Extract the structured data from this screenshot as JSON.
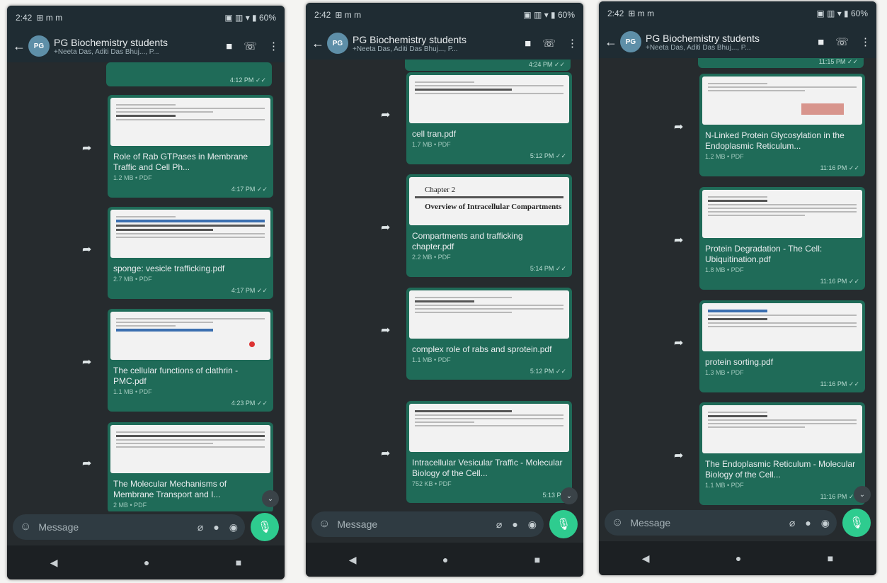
{
  "screens": [
    {
      "status": {
        "time": "2:42",
        "left_icons": "⊞ m m",
        "right_icons": "▣ ▥ ▾ ▮ 60%"
      },
      "header": {
        "name": "PG Biochemistry students",
        "members": "+Neeta Das, Aditi Das Bhuj..., P...",
        "avatar_text": "PG"
      },
      "top_time": "4:12 PM ✓✓",
      "messages": [
        {
          "preview": "plain",
          "file": "Role of Rab GTPases in Membrane Traffic and Cell Ph...",
          "meta": "1.2 MB • PDF",
          "time": "4:17 PM ✓✓"
        },
        {
          "preview": "blue",
          "file": "sponge: vesicle trafficking.pdf",
          "meta": "2.7 MB • PDF",
          "time": "4:17 PM ✓✓"
        },
        {
          "preview": "red",
          "file": "The cellular functions of clathrin - PMC.pdf",
          "meta": "1.1 MB • PDF",
          "time": "4:23 PM ✓✓"
        },
        {
          "preview": "plain",
          "file": "The Molecular Mechanisms of Membrane Transport and I...",
          "meta": "2 MB • PDF",
          "time": ""
        }
      ],
      "input": {
        "placeholder": "Message"
      }
    },
    {
      "status": {
        "time": "2:42",
        "left_icons": "⊞ m m",
        "right_icons": "▣ ▥ ▾ ▮ 60%"
      },
      "header": {
        "name": "PG Biochemistry students",
        "members": "+Neeta Das, Aditi Das Bhuj..., P...",
        "avatar_text": "PG"
      },
      "top_time": "4:24 PM ✓✓",
      "messages": [
        {
          "preview": "plain",
          "file": "cell tran.pdf",
          "meta": "1.7 MB • PDF",
          "time": "5:12 PM ✓✓"
        },
        {
          "preview": "chapter",
          "preview_title": "Overview of Intracellular Compartments",
          "preview_head": "Chapter 2",
          "file": "Compartments and trafficking chapter.pdf",
          "meta": "2.2 MB • PDF",
          "time": "5:14 PM ✓✓"
        },
        {
          "preview": "plain",
          "file": "complex role of rabs and sprotein.pdf",
          "meta": "1.1 MB • PDF",
          "time": "5:12 PM ✓✓"
        },
        {
          "preview": "plain",
          "file": "Intracellular Vesicular Traffic - Molecular Biology of the Cell...",
          "meta": "752 KB • PDF",
          "time": "5:13 PM"
        }
      ],
      "input": {
        "placeholder": "Message"
      }
    },
    {
      "status": {
        "time": "2:42",
        "left_icons": "⊞ m m",
        "right_icons": "▣ ▥ ▾ ▮ 60%"
      },
      "header": {
        "name": "PG Biochemistry students",
        "members": "+Neeta Das, Aditi Das Bhuj..., P...",
        "avatar_text": "PG"
      },
      "top_time": "11:15 PM ✓✓",
      "messages": [
        {
          "preview": "seal",
          "file": "N-Linked Protein Glycosylation in the Endoplasmic Reticulum...",
          "meta": "1.2 MB • PDF",
          "time": "11:16 PM ✓✓"
        },
        {
          "preview": "plain",
          "file": "Protein Degradation - The Cell: Ubiquitination.pdf",
          "meta": "1.8 MB • PDF",
          "time": "11:16 PM ✓✓"
        },
        {
          "preview": "plain",
          "file": "protein sorting.pdf",
          "meta": "1.3 MB • PDF",
          "time": "11:16 PM ✓✓"
        },
        {
          "preview": "plain",
          "file": "The Endoplasmic Reticulum - Molecular Biology of the Cell...",
          "meta": "1.1 MB • PDF",
          "time": "11:16 PM ✓✓"
        }
      ],
      "input": {
        "placeholder": "Message"
      }
    }
  ],
  "icons": {
    "back": "←",
    "video": "■",
    "call": "☏",
    "more": "⋮",
    "share": "➦",
    "emoji": "☺",
    "attach": "⌀",
    "rupee": "●",
    "camera": "◉",
    "mic": "🎙",
    "nav_back": "◀",
    "nav_home": "●",
    "nav_recent": "■",
    "scroll_down": "⌄"
  },
  "colors": {
    "bubble": "#1f6b58",
    "header": "#1f2c33",
    "background": "#262b2e",
    "mic": "#2ecc8f"
  }
}
